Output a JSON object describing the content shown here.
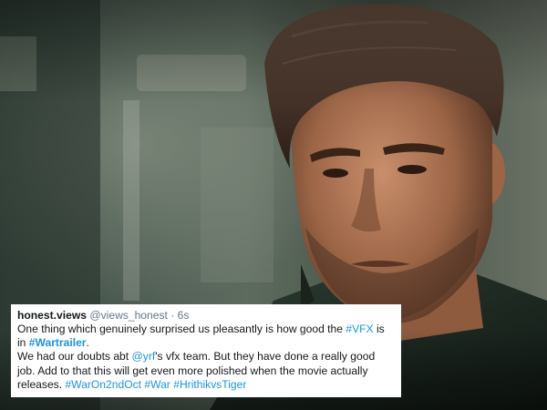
{
  "tweet": {
    "display_name": "honest.views",
    "handle": "@views_honest",
    "separator": "·",
    "time": "6s",
    "p1": {
      "t1": "One thing which genuinely surprised us pleasantly is how good the ",
      "tag_vfx": "#VFX",
      "t2": " is in ",
      "tag_wartrailer": "#Wartrailer",
      "t3": "."
    },
    "p2": {
      "t1": "We had our doubts abt ",
      "mention": "@yrf",
      "t2": "'s vfx team. But they have done a really good job. Add to that this will get even more polished when the movie actually releases. ",
      "tag1": "#WarOn2ndOct",
      "tag2": "#War",
      "tag3": "#HrithikvsTiger"
    }
  },
  "colors": {
    "link": "#1b95e0",
    "text": "#14171a",
    "muted": "#657786",
    "card_bg": "#ffffff"
  }
}
